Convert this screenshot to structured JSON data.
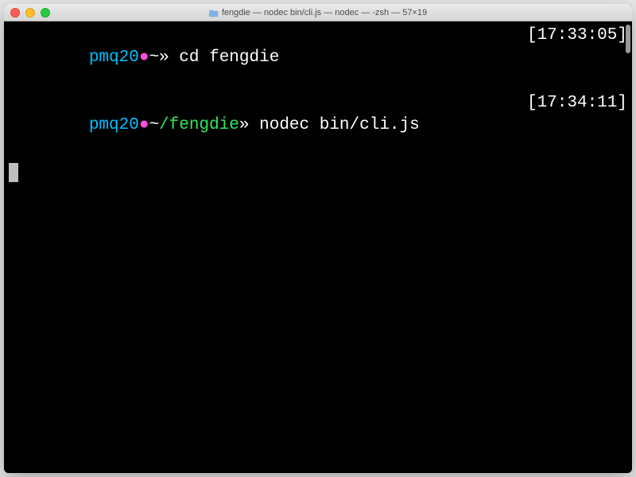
{
  "window": {
    "title": "fengdie — nodec bin/cli.js — nodec — -zsh — 57×19"
  },
  "lines": [
    {
      "user": "pmq20",
      "dot": "●",
      "tilde": "~",
      "path": "",
      "arrows": "»",
      "command": "cd fengdie",
      "time": "[17:33:05]"
    },
    {
      "user": "pmq20",
      "dot": "●",
      "tilde": "~",
      "path": "/fengdie",
      "arrows": "»",
      "command": "nodec bin/cli.js",
      "time": "[17:34:11]"
    }
  ]
}
